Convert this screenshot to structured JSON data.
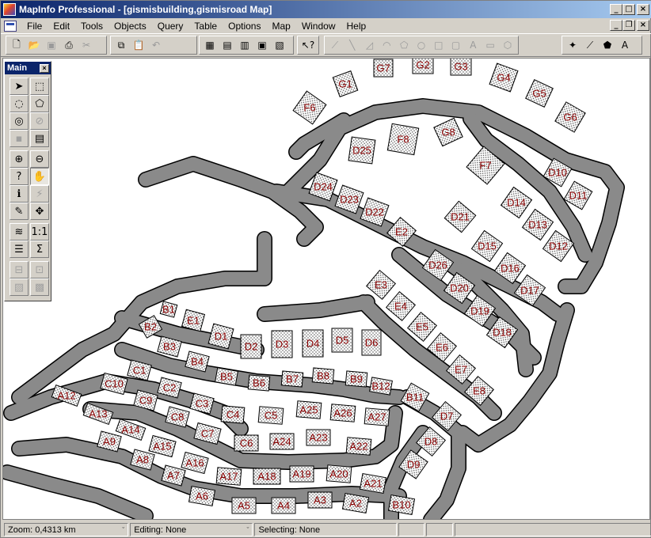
{
  "window": {
    "title": "MapInfo Professional - [gismisbuilding,gismisroad Map]",
    "minimize": "_",
    "maximize": "□",
    "close": "×",
    "mdi_minimize": "_",
    "mdi_restore": "❐",
    "mdi_close": "×"
  },
  "menu": [
    "File",
    "Edit",
    "Tools",
    "Objects",
    "Query",
    "Table",
    "Options",
    "Map",
    "Window",
    "Help"
  ],
  "palette": {
    "title": "Main",
    "close": "×"
  },
  "map": {
    "background": "#ffffff",
    "road_color": "#8a8a8a",
    "building_label_color": "#8b0000",
    "building_labels": [
      "F6",
      "G1",
      "G7",
      "G2",
      "G3",
      "G4",
      "G5",
      "G6",
      "G8",
      "F8",
      "D25",
      "F7",
      "D10",
      "D11",
      "D24",
      "D23",
      "D22",
      "D21",
      "D14",
      "D13",
      "D12",
      "E2",
      "D26",
      "D15",
      "D16",
      "D20",
      "D17",
      "E3",
      "E4",
      "D19",
      "D18",
      "E5",
      "E6",
      "E7",
      "E8",
      "B1",
      "E1",
      "B2",
      "D1",
      "D2",
      "D3",
      "D4",
      "D5",
      "D6",
      "B3",
      "B4",
      "B5",
      "B6",
      "B7",
      "B8",
      "B9",
      "B12",
      "C1",
      "C10",
      "C2",
      "C9",
      "C3",
      "C8",
      "C4",
      "C5",
      "A25",
      "A26",
      "A27",
      "B11",
      "D7",
      "A12",
      "A13",
      "A14",
      "C7",
      "C6",
      "A24",
      "A23",
      "A22",
      "D8",
      "A9",
      "A15",
      "A16",
      "A8",
      "A7",
      "A17",
      "A18",
      "A19",
      "A20",
      "A21",
      "D9",
      "A6",
      "A5",
      "A4",
      "A3",
      "A2",
      "B10"
    ]
  },
  "status": {
    "zoom": "Zoom: 0,4313 km",
    "editing": "Editing: None",
    "selecting": "Selecting: None"
  }
}
